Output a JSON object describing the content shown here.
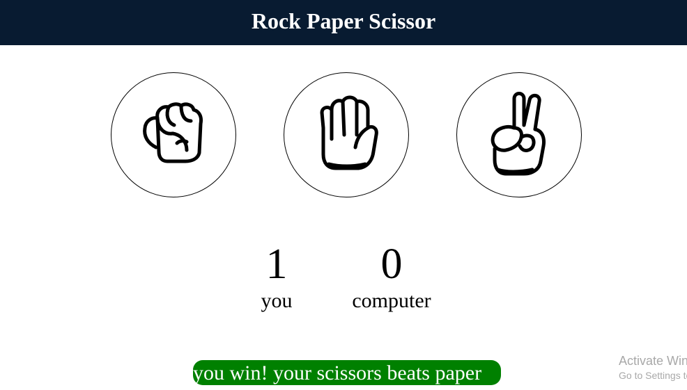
{
  "header": {
    "title": "Rock Paper Scissor"
  },
  "choices": [
    {
      "id": "rock",
      "icon": "fist-icon"
    },
    {
      "id": "paper",
      "icon": "open-hand-icon"
    },
    {
      "id": "scissors",
      "icon": "peace-hand-icon"
    }
  ],
  "scoreboard": {
    "user": {
      "score": "1",
      "label": "you"
    },
    "computer": {
      "score": "0",
      "label": "computer"
    }
  },
  "message": {
    "text": "you win! your scissors beats paper",
    "color": "#008000"
  },
  "windows_watermark": {
    "line1": "Activate Windows",
    "line2": "Go to Settings to activate Windows."
  },
  "colors": {
    "header_bg": "#081b31",
    "win": "#008000"
  }
}
